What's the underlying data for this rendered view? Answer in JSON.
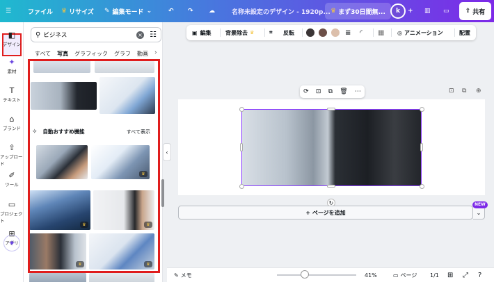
{
  "topbar": {
    "file": "ファイル",
    "resize": "リサイズ",
    "edit_mode": "編集モード",
    "doc_title": "名称未設定のデザイン - 1920p...",
    "trial": "まず30日間無...",
    "avatar_initial": "k",
    "share": "共有"
  },
  "rail": {
    "items": [
      {
        "label": "デザイン",
        "icon": "layout-icon"
      },
      {
        "label": "素材",
        "icon": "elements-icon"
      },
      {
        "label": "テキスト",
        "icon": "text-icon"
      },
      {
        "label": "ブランド",
        "icon": "brand-icon"
      },
      {
        "label": "アップロード",
        "icon": "upload-icon"
      },
      {
        "label": "ツール",
        "icon": "draw-icon"
      },
      {
        "label": "プロジェクト",
        "icon": "folder-icon"
      },
      {
        "label": "アプリ",
        "icon": "apps-icon"
      }
    ]
  },
  "panel": {
    "search_value": "ビジネス",
    "tabs": [
      "すべて",
      "写真",
      "グラフィック",
      "グラフ",
      "動画"
    ],
    "active_tab": "写真",
    "recommend_title": "自動おすすめ機能",
    "see_all": "すべて表示"
  },
  "context_toolbar": {
    "edit": "編集",
    "bg_remove": "背景除去",
    "flip": "反転",
    "animate": "アニメーション",
    "position": "配置",
    "colors": [
      "#3b3536",
      "#6d5048",
      "#dcbfab"
    ]
  },
  "canvas": {
    "add_page": "+ ページを追加",
    "new_badge": "NEW"
  },
  "bottombar": {
    "notes": "メモ",
    "zoom": "41%",
    "pages": "ページ",
    "page_count": "1/1"
  },
  "colors": {
    "accent": "#8b3dff",
    "highlight": "#e01d1d"
  }
}
